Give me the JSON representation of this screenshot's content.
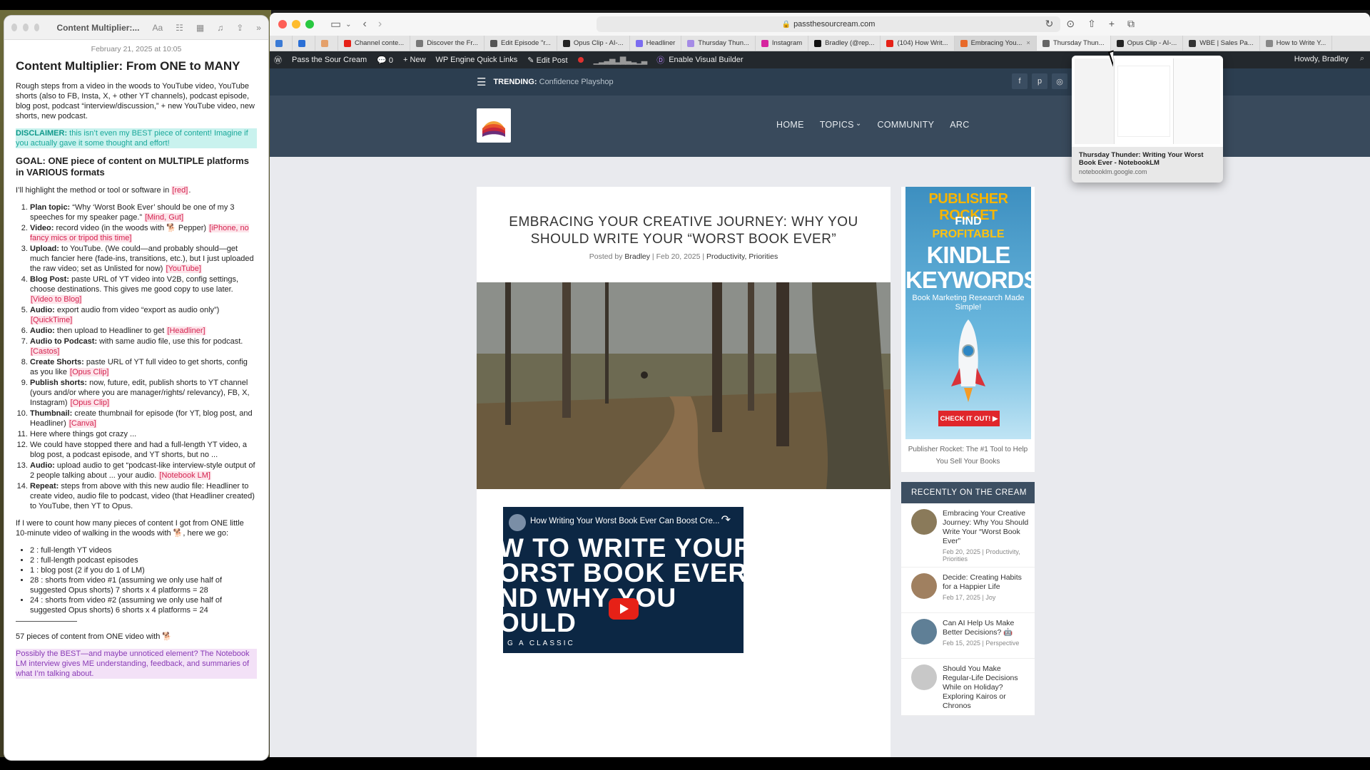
{
  "notes": {
    "window_title": "Content Multiplier:...",
    "toolbar_icons": [
      "text-format-icon",
      "checklist-icon",
      "table-icon",
      "audio-icon",
      "share-icon",
      "more-icon"
    ],
    "date": "February 21, 2025 at 10:05",
    "title": "Content Multiplier: From ONE to MANY",
    "intro": "Rough steps from a video in the woods to YouTube video, YouTube shorts (also to FB, Insta, X, + other YT channels), podcast episode, blog post, podcast “interview/discussion,” + new YouTube video, new shorts, new podcast.",
    "disclaimer_label": "DISCLAIMER:",
    "disclaimer_text": "this isn’t even my BEST piece of content! Imagine if you actually gave it some thought and effort!",
    "goal": "GOAL: ONE piece of content on MULTIPLE platforms in VARIOUS formats",
    "highlight_note_text": "I’ll highlight the method or tool or software in",
    "highlight_note_tag": "[red]",
    "steps": [
      {
        "label": "Plan topic:",
        "text": "“Why ‘Worst Book Ever’ should be one of my 3 speeches for my speaker page.”",
        "tag": "[Mind, Gut]"
      },
      {
        "label": "Video:",
        "text": "record video (in the woods with 🐕 Pepper)",
        "tag": "[iPhone, no fancy mics or tripod this time]"
      },
      {
        "label": "Upload:",
        "text": "to YouTube. (We could—and probably should—get much fancier here (fade-ins, transitions, etc.), but I just uploaded the raw video; set as Unlisted for now)",
        "tag": "[YouTube]"
      },
      {
        "label": "Blog Post:",
        "text": "paste URL of YT video into V2B, config settings, choose destinations. This gives me good copy to use later.",
        "tag": "[Video to Blog]"
      },
      {
        "label": "Audio:",
        "text": "export audio from video “export as audio only”)",
        "tag": "[QuickTime]"
      },
      {
        "label": "Audio:",
        "text": "then upload to Headliner to get",
        "tag": "[Headliner]"
      },
      {
        "label": "Audio to Podcast:",
        "text": "with same audio file, use this for podcast.",
        "tag": "[Castos]"
      },
      {
        "label": "Create Shorts:",
        "text": "paste URL of YT full video to get shorts, config as you like",
        "tag": "[Opus Clip]"
      },
      {
        "label": "Publish shorts:",
        "text": "now, future, edit, publish shorts to YT channel (yours and/or where you are manager/rights/ relevancy), FB, X, Instagram)",
        "tag": "[Opus Clip]"
      },
      {
        "label": "Thumbnail:",
        "text": "create thumbnail for episode (for YT, blog post, and Headliner)",
        "tag": "[Canva]"
      },
      {
        "label": "",
        "text": "Here where things got crazy ...",
        "tag": ""
      },
      {
        "label": "",
        "text": "We could have stopped there and had a full-length YT video, a blog post, a podcast episode, and YT shorts, but no ...",
        "tag": ""
      },
      {
        "label": "Audio:",
        "text": "upload audio to get “podcast-like interview-style output of 2 people talking about ... your audio.",
        "tag": "[Notebook LM]"
      },
      {
        "label": "Repeat:",
        "text": "steps from above with this new audio file: Headliner to create video, audio file to podcast, video (that Headliner created) to YouTube, then YT to Opus.",
        "tag": ""
      }
    ],
    "count_intro": "If I were to count how many pieces of content I got from ONE little 10-minute video of walking in the woods with 🐕, here we go:",
    "counts": [
      "2 : full-length YT videos",
      "2 :  full-length podcast episodes",
      "1 : blog post (2 if you do 1 of LM)",
      "28 : shorts from video #1 (assuming we only use half of suggested Opus shorts) 7 shorts x 4 platforms = 28",
      "24 : shorts from video #2 (assuming we only use half of suggested Opus shorts) 6 shorts x 4 platforms = 24"
    ],
    "total": "57 pieces of content from ONE video with 🐕",
    "closing": "Possibly the BEST—and maybe unnoticed element? The Notebook LM interview gives ME understanding, feedback, and summaries of what I’m talking about."
  },
  "browser": {
    "url": "passthesourcream.com",
    "tabs": [
      {
        "label": "Channel conte...",
        "color": "#e62117"
      },
      {
        "label": "Discover the Fr...",
        "color": "#777777"
      },
      {
        "label": "Edit Episode \"r...",
        "color": "#555555"
      },
      {
        "label": "Opus Clip - AI-...",
        "color": "#222222"
      },
      {
        "label": "Headliner",
        "color": "#7b6cf0"
      },
      {
        "label": "Thursday Thun...",
        "color": "#a58be6"
      },
      {
        "label": "Instagram",
        "color": "#d6249f"
      },
      {
        "label": "Bradley (@rep...",
        "color": "#111111"
      },
      {
        "label": "(104) How Writ...",
        "color": "#e62117"
      },
      {
        "label": "Embracing You...",
        "color": "#e86a2a"
      },
      {
        "label": "Thursday Thun...",
        "color": "#666666"
      },
      {
        "label": "Opus Clip - AI-...",
        "color": "#222222"
      },
      {
        "label": "WBE | Sales Pa...",
        "color": "#333333"
      },
      {
        "label": "How to Write Y...",
        "color": "#888888"
      }
    ],
    "tab_preview": {
      "title": "Thursday Thunder: Writing Your Worst Book Ever - NotebookLM",
      "url": "notebooklm.google.com"
    }
  },
  "wp_admin": {
    "site_name": "Pass the Sour Cream",
    "comments": "0",
    "new": "New",
    "quick_links": "WP Engine Quick Links",
    "edit_post": "Edit Post",
    "visual_builder": "Enable Visual Builder",
    "howdy": "Howdy, Bradley"
  },
  "site": {
    "trending_label": "TRENDING:",
    "trending_text": "Confidence Playshop",
    "socials": [
      "f",
      "p",
      "ig"
    ],
    "menu": [
      "HOME",
      "TOPICS",
      "COMMUNITY",
      "ARC"
    ],
    "post": {
      "title": "EMBRACING YOUR CREATIVE JOURNEY: WHY YOU SHOULD WRITE YOUR “WORST BOOK EVER”",
      "posted_by": "Posted by",
      "author": "Bradley",
      "date": "Feb 20, 2025",
      "categories": "Productivity, Priorities",
      "video_title": "How Writing Your Worst Book Ever Can Boost Cre...",
      "video_lines": [
        "W TO WRITE YOUR",
        "ORST BOOK EVER\"",
        "ND WHY YOU",
        "OULD"
      ],
      "video_small": "G A CLASSIC"
    },
    "ad": {
      "brand": "PUBLISHER ROCKET",
      "find": "FIND",
      "profitable": "PROFITABLE",
      "kindle": "KINDLE",
      "keywords": "KEYWORDS",
      "sub": "Book Marketing Research Made Simple!",
      "cta": "CHECK IT OUT!",
      "caption": "Publisher Rocket: The #1 Tool to Help You Sell Your Books"
    },
    "recent_heading": "RECENTLY ON THE CREAM",
    "recent": [
      {
        "title": "Embracing Your Creative Journey: Why You Should Write Your “Worst Book Ever”",
        "date": "Feb 20, 2025",
        "cats": "Productivity, Priorities"
      },
      {
        "title": "Decide: Creating Habits for a Happier Life",
        "date": "Feb 17, 2025",
        "cats": "Joy"
      },
      {
        "title": "Can AI Help Us Make Better Decisions? 🤖",
        "date": "Feb 15, 2025",
        "cats": "Perspective"
      },
      {
        "title": "Should You Make Regular-Life Decisions While on Holiday? Exploring Kairos or Chronos",
        "date": "",
        "cats": ""
      }
    ]
  }
}
